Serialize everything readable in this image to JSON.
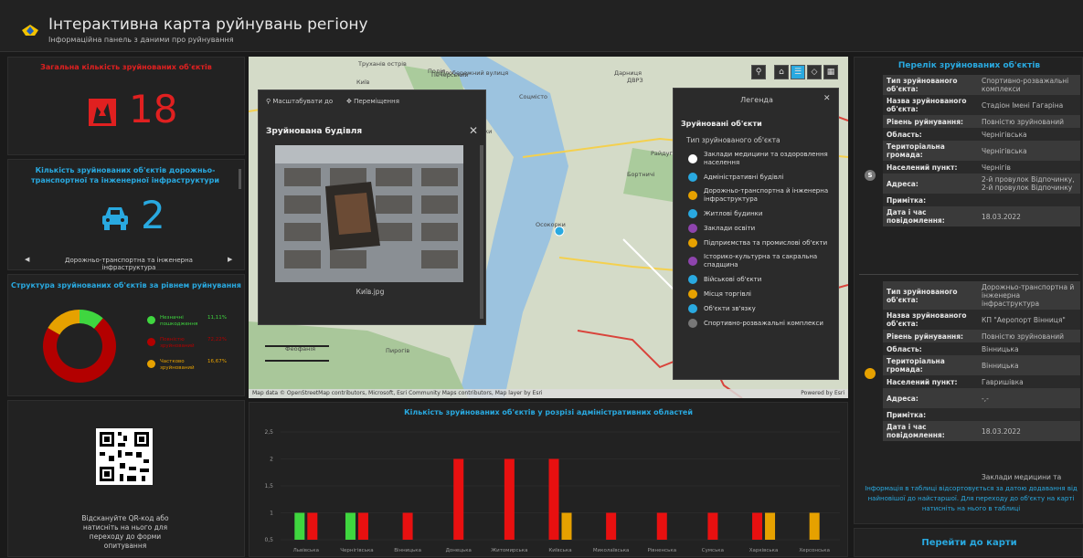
{
  "header": {
    "title": "Інтерактивна карта руйнувань регіону",
    "subtitle": "Інформаційна панель з даними про руйнування"
  },
  "total": {
    "title": "Загальна кількість зруйнованих об'єктів",
    "value": "18"
  },
  "infra": {
    "title": "Кількість зруйнованих об'єктів дорожньо-транспортної та інженерної інфраструктури",
    "value": "2",
    "selector_label": "Дорожньо-транспортна та інженерна інфраструктура"
  },
  "structure": {
    "title": "Структура зруйнованих об'єктів за рівнем руйнування",
    "items": [
      {
        "label": "Незначні пошкодження",
        "value": "11,11%",
        "fraction": 0.1111,
        "color": "#3fd63f"
      },
      {
        "label": "Повністю зруйнований",
        "value": "72,22%",
        "fraction": 0.7222,
        "color": "#b30000"
      },
      {
        "label": "Частково зруйнований",
        "value": "16,67%",
        "fraction": 0.1667,
        "color": "#e6a100"
      }
    ]
  },
  "qr": {
    "text": "Відскануйте QR-код або натисніть на нього для переходу до форми опитування"
  },
  "map": {
    "places": [
      "Київ",
      "Печерський",
      "Поділ",
      "Позняки",
      "Осокорки",
      "Бортничі",
      "Пирогів",
      "Феофанія",
      "Труханів острів",
      "Плобережний вулиця",
      "Дарниця",
      "Соцмісто",
      "Березняки",
      "Райдуга",
      "ДВРЗ"
    ],
    "attribution": "Map data © OpenStreetMap contributors, Microsoft, Esri Community Maps contributors, Map layer by Esri",
    "powered": "Powered by Esri",
    "popup": {
      "zoom_label": "Масштабувати до",
      "move_label": "Переміщення",
      "title": "Зруйнована будівля",
      "caption": "Київ.jpg"
    },
    "legend": {
      "title": "Легенда",
      "layer": "Зруйновані об'єкти",
      "field": "Тип зруйнованого об'єкта",
      "items": [
        {
          "label": "Заклади медицини та оздоровлення населення",
          "color": "#ffffff",
          "icon": "medical-icon"
        },
        {
          "label": "Адміністративні будівлі",
          "color": "#29a9e0",
          "icon": "admin-building-icon"
        },
        {
          "label": "Дорожньо-транспортна й інженерна інфраструктура",
          "color": "#e6a100",
          "icon": "transport-icon"
        },
        {
          "label": "Житлові будинки",
          "color": "#29a9e0",
          "icon": "house-icon"
        },
        {
          "label": "Заклади освіти",
          "color": "#8e44ad",
          "icon": "education-icon"
        },
        {
          "label": "Підприємства та промислові об'єкти",
          "color": "#e6a100",
          "icon": "factory-icon"
        },
        {
          "label": "Історико-культурна та сакральна спадщина",
          "color": "#8e44ad",
          "icon": "heritage-icon"
        },
        {
          "label": "Військові об'єкти",
          "color": "#29a9e0",
          "icon": "military-icon"
        },
        {
          "label": "Місця торгівлі",
          "color": "#e6a100",
          "icon": "shop-icon"
        },
        {
          "label": "Об'єкти зв'язку",
          "color": "#29a9e0",
          "icon": "communication-icon"
        },
        {
          "label": "Спортивно-розважальні комплекси",
          "color": "#777777",
          "icon": "sport-icon"
        }
      ]
    }
  },
  "chart": {
    "title": "Кількість зруйнованих об'єктів у розрізі адміністративних областей"
  },
  "chart_data": {
    "type": "bar",
    "title": "Кількість зруйнованих об'єктів у розрізі адміністративних областей",
    "categories": [
      "Львівська",
      "Чернігівська",
      "Вінницька",
      "Донецька",
      "Житомирська",
      "Київська",
      "Миколаївська",
      "Рівненська",
      "Сумська",
      "Харківська",
      "Херсонська"
    ],
    "series": [
      {
        "color": "#3fd63f",
        "values": [
          1,
          1,
          0,
          0,
          0,
          0,
          0,
          0,
          0,
          0,
          0
        ]
      },
      {
        "color": "#e81010",
        "values": [
          1,
          1,
          1,
          2,
          2,
          2,
          1,
          1,
          1,
          1,
          0
        ]
      },
      {
        "color": "#e6a100",
        "values": [
          0,
          0,
          0,
          0,
          0,
          1,
          0,
          0,
          0,
          1,
          1
        ]
      }
    ],
    "yticks": [
      "0,5",
      "1",
      "1,5",
      "2",
      "2,5"
    ],
    "ylim": [
      0.5,
      2.5
    ]
  },
  "list": {
    "title": "Перелік зруйнованих об'єктів",
    "records": [
      {
        "badge": "S",
        "badge_color": "#777777",
        "rows": [
          {
            "k": "Тип зруйнованого об'єкта:",
            "v": "Спортивно-розважальні комплекси"
          },
          {
            "k": "Назва зруйнованого об'єкта:",
            "v": "Стадіон Імені Гагаріна"
          },
          {
            "k": "Рівень руйнування:",
            "v": "Повністю зруйнований"
          },
          {
            "k": "Область:",
            "v": "Чернігівська"
          },
          {
            "k": "Територіальна громада:",
            "v": "Чернігівська"
          },
          {
            "k": "Населений пункт:",
            "v": "Чернігів"
          },
          {
            "k": "Адреса:",
            "v": "2-й провулок Відпочинку, 2-й провулок Відпочинку"
          },
          {
            "k": "Примітка:",
            "v": ""
          },
          {
            "k": "Дата і час повідомлення:",
            "v": "18.03.2022"
          }
        ]
      },
      {
        "badge": "",
        "badge_color": "#e6a100",
        "rows": [
          {
            "k": "Тип зруйнованого об'єкта:",
            "v": "Дорожньо-транспортна й інженерна інфраструктура"
          },
          {
            "k": "Назва зруйнованого об'єкта:",
            "v": "КП \"Аеропорт Вінниця\""
          },
          {
            "k": "Рівень руйнування:",
            "v": "Повністю зруйнований"
          },
          {
            "k": "Область:",
            "v": "Вінницька"
          },
          {
            "k": "Територіальна громада:",
            "v": "Вінницька"
          },
          {
            "k": "Населений пункт:",
            "v": "Гавришівка"
          },
          {
            "k": "Адреса:",
            "v": "-,-"
          },
          {
            "k": "Примітка:",
            "v": ""
          },
          {
            "k": "Дата і час повідомлення:",
            "v": "18.03.2022"
          }
        ]
      }
    ],
    "partial_row": "Заклади медицини та",
    "note": "Інформація в таблиці відсортовується за датою додавання від найновішої до найстаршої. Для переходу до об'єкту на карті натисніть на нього в таблиці",
    "goto_label": "Перейти до карти"
  }
}
